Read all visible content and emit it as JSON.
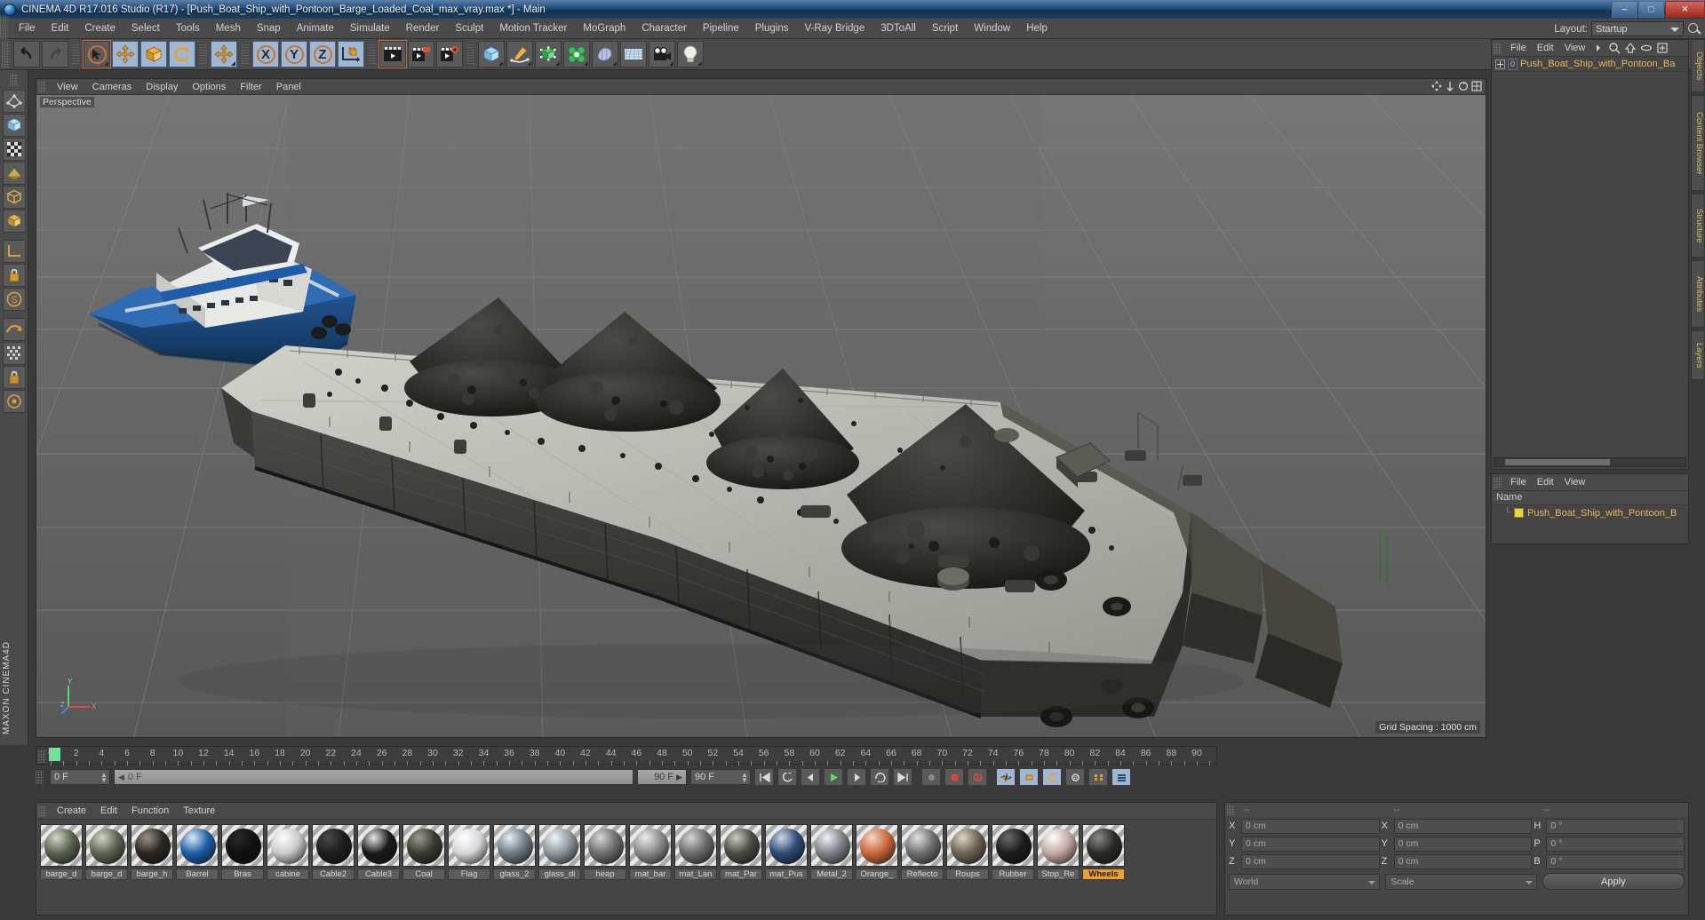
{
  "window": {
    "title": "CINEMA 4D R17.016 Studio (R17) - [Push_Boat_Ship_with_Pontoon_Barge_Loaded_Coal_max_vray.max *] - Main",
    "minimize": "–",
    "maximize": "□",
    "close": "✕"
  },
  "menubar": {
    "items": [
      "File",
      "Edit",
      "Create",
      "Select",
      "Tools",
      "Mesh",
      "Snap",
      "Animate",
      "Simulate",
      "Render",
      "Sculpt",
      "Motion Tracker",
      "MoGraph",
      "Character",
      "Pipeline",
      "Plugins",
      "V-Ray Bridge",
      "3DToAll",
      "Script",
      "Window",
      "Help"
    ],
    "layout_label": "Layout:",
    "layout_value": "Startup"
  },
  "toolbar": {
    "axis_x": "X",
    "axis_y": "Y",
    "axis_z": "Z"
  },
  "viewport": {
    "menu": [
      "View",
      "Cameras",
      "Display",
      "Options",
      "Filter",
      "Panel"
    ],
    "label": "Perspective",
    "grid_spacing": "Grid Spacing : 1000 cm",
    "axis_x": "X",
    "axis_y": "Y",
    "axis_z": "Z"
  },
  "timeline": {
    "numbers": [
      0,
      2,
      4,
      6,
      8,
      10,
      12,
      14,
      16,
      18,
      20,
      22,
      24,
      26,
      28,
      30,
      32,
      34,
      36,
      38,
      40,
      42,
      44,
      46,
      48,
      50,
      52,
      54,
      56,
      58,
      60,
      62,
      64,
      66,
      68,
      70,
      72,
      74,
      76,
      78,
      80,
      82,
      84,
      86,
      88,
      90
    ],
    "max_frame": 90,
    "current_frame_field": "0 F",
    "current_frame_field2": "0 F",
    "end_field": "90 F",
    "range_field": "90 F",
    "right_field": "0 F"
  },
  "materials": {
    "menu": [
      "Create",
      "Edit",
      "Function",
      "Texture"
    ],
    "items": [
      {
        "name": "barge_d",
        "color": "#5b6250",
        "highlight": "#cfd6c4"
      },
      {
        "name": "barge_d",
        "color": "#5d6452",
        "highlight": "#d2d8c8"
      },
      {
        "name": "barge_h",
        "color": "#2a2723",
        "highlight": "#9a9288"
      },
      {
        "name": "Barrel",
        "color": "#1b5fa8",
        "highlight": "#dfe9f4"
      },
      {
        "name": "Bras",
        "color": "#101010",
        "highlight": "#2a2a2a"
      },
      {
        "name": "cabine",
        "color": "#c9c9c9",
        "highlight": "#ffffff"
      },
      {
        "name": "Cable2",
        "color": "#1d1d1d",
        "highlight": "#4a4a4a"
      },
      {
        "name": "Cable3",
        "color": "#1a1a1a",
        "highlight": "#e8e8e8"
      },
      {
        "name": "Coal",
        "color": "#3a3a33",
        "highlight": "#9b9b8e"
      },
      {
        "name": "Flag",
        "color": "#d8d8dc",
        "highlight": "#ffffff"
      },
      {
        "name": "glass_2",
        "color": "#6e7a84",
        "highlight": "#e6eef5"
      },
      {
        "name": "glass_di",
        "color": "#8d949a",
        "highlight": "#f0f4f7"
      },
      {
        "name": "heap",
        "color": "#6d6d6d",
        "highlight": "#d8d8d8"
      },
      {
        "name": "mat_bar",
        "color": "#8b8b8b",
        "highlight": "#ededed"
      },
      {
        "name": "mat_Lan",
        "color": "#6b6b6b",
        "highlight": "#d4d4d4"
      },
      {
        "name": "mat_Par",
        "color": "#4a4a46",
        "highlight": "#c9c9bd"
      },
      {
        "name": "mat_Pus",
        "color": "#2e4a75",
        "highlight": "#cfd9e6"
      },
      {
        "name": "Metal_2",
        "color": "#7d8186",
        "highlight": "#f0f3f6"
      },
      {
        "name": "Orange_",
        "color": "#c8673a",
        "highlight": "#f6d6c2"
      },
      {
        "name": "Reflecto",
        "color": "#6e6e6e",
        "highlight": "#e2e2e2"
      },
      {
        "name": "Roups",
        "color": "#6d6354",
        "highlight": "#ddd5c4"
      },
      {
        "name": "Rubber",
        "color": "#1c1c1c",
        "highlight": "#6a6a6a"
      },
      {
        "name": "Stop_Re",
        "color": "#c2a8a2",
        "highlight": "#ffffff"
      },
      {
        "name": "Wheels",
        "color": "#2b2b28",
        "highlight": "#8c8c84",
        "selected": true
      }
    ]
  },
  "object_manager": {
    "menu": [
      "File",
      "Edit",
      "View"
    ],
    "items": [
      {
        "name": "Push_Boat_Ship_with_Pontoon_Ba",
        "badge": "0"
      }
    ]
  },
  "layer_manager": {
    "menu": [
      "File",
      "Edit",
      "View"
    ],
    "column": "Name",
    "items": [
      {
        "name": "Push_Boat_Ship_with_Pontoon_B",
        "color": "#e8d34a"
      }
    ]
  },
  "right_tabs": [
    "Objects",
    "Content Browser",
    "Structure",
    "Attributes",
    "Layers"
  ],
  "coordinates": {
    "headers": [
      "--",
      "--",
      "--"
    ],
    "rows": [
      {
        "pos_label": "X",
        "pos_value": "0 cm",
        "size_label": "X",
        "size_value": "0 cm",
        "rot_label": "H",
        "rot_value": "0 °"
      },
      {
        "pos_label": "Y",
        "pos_value": "0 cm",
        "size_label": "Y",
        "size_value": "0 cm",
        "rot_label": "P",
        "rot_value": "0 °"
      },
      {
        "pos_label": "Z",
        "pos_value": "0 cm",
        "size_label": "Z",
        "size_value": "0 cm",
        "rot_label": "B",
        "rot_value": "0 °"
      }
    ],
    "system": "World",
    "mode": "Scale",
    "apply": "Apply"
  },
  "branding": "MAXON CINEMA4D",
  "colors": {
    "accent": "#f0a028",
    "orange": "#e8a33d",
    "panel": "#454545",
    "toolbar": "#4a4a4a"
  }
}
